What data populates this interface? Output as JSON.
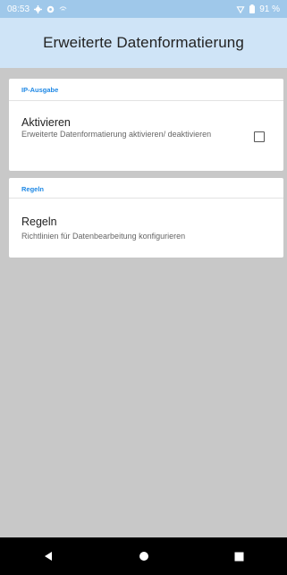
{
  "status_bar": {
    "time": "08:53",
    "battery": "91 %",
    "icons": [
      "gear-icon",
      "shield-icon",
      "wifi-icon",
      "battery-icon"
    ]
  },
  "app_bar": {
    "title": "Erweiterte Datenformatierung",
    "background": "#cfe4f7"
  },
  "sections": [
    {
      "header": "IP-Ausgabe",
      "item": {
        "title": "Aktivieren",
        "summary": "Erweiterte Datenformatierung aktivieren/ deaktivieren",
        "checked": false
      }
    },
    {
      "header": "Regeln",
      "item": {
        "title": "Regeln",
        "summary": "Richtlinien für Datenbearbeitung konfigurieren"
      }
    }
  ],
  "nav_bar": {
    "icons": [
      "back-icon",
      "home-icon",
      "recents-icon"
    ]
  },
  "colors": {
    "accent": "#1e88e5",
    "status_bar": "#9fc8ea",
    "page_background": "#c8c8c8"
  }
}
